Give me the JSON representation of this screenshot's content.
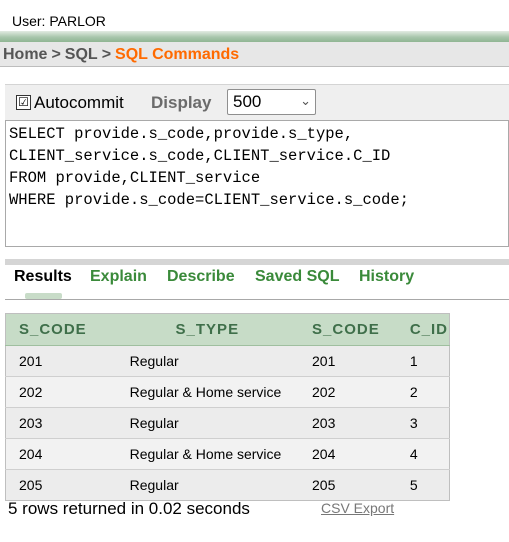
{
  "user_line": "User: PARLOR",
  "breadcrumb": {
    "home": "Home",
    "sep1": ">",
    "sql": "SQL",
    "sep2": ">",
    "current": "SQL Commands"
  },
  "toolbar": {
    "autocommit_check": "☑",
    "autocommit_label": "Autocommit",
    "display_label": "Display",
    "display_value": "500",
    "chevron": "⌄"
  },
  "editor": {
    "lines": [
      "SELECT provide.s_code,provide.s_type,",
      "CLIENT_service.s_code,CLIENT_service.C_ID",
      "FROM provide,CLIENT_service",
      "WHERE provide.s_code=CLIENT_service.s_code;"
    ]
  },
  "tabs": [
    "Results",
    "Explain",
    "Describe",
    "Saved SQL",
    "History"
  ],
  "results": {
    "columns": [
      "S_CODE",
      "S_TYPE",
      "S_CODE",
      "C_ID"
    ],
    "rows": [
      [
        "201",
        "Regular",
        "201",
        "1"
      ],
      [
        "202",
        "Regular & Home service",
        "202",
        "2"
      ],
      [
        "203",
        "Regular",
        "203",
        "3"
      ],
      [
        "204",
        "Regular & Home service",
        "204",
        "4"
      ],
      [
        "205",
        "Regular",
        "205",
        "5"
      ]
    ]
  },
  "footer": {
    "rows_returned": "5 rows returned in 0.02 seconds",
    "csv_export": "CSV Export"
  }
}
